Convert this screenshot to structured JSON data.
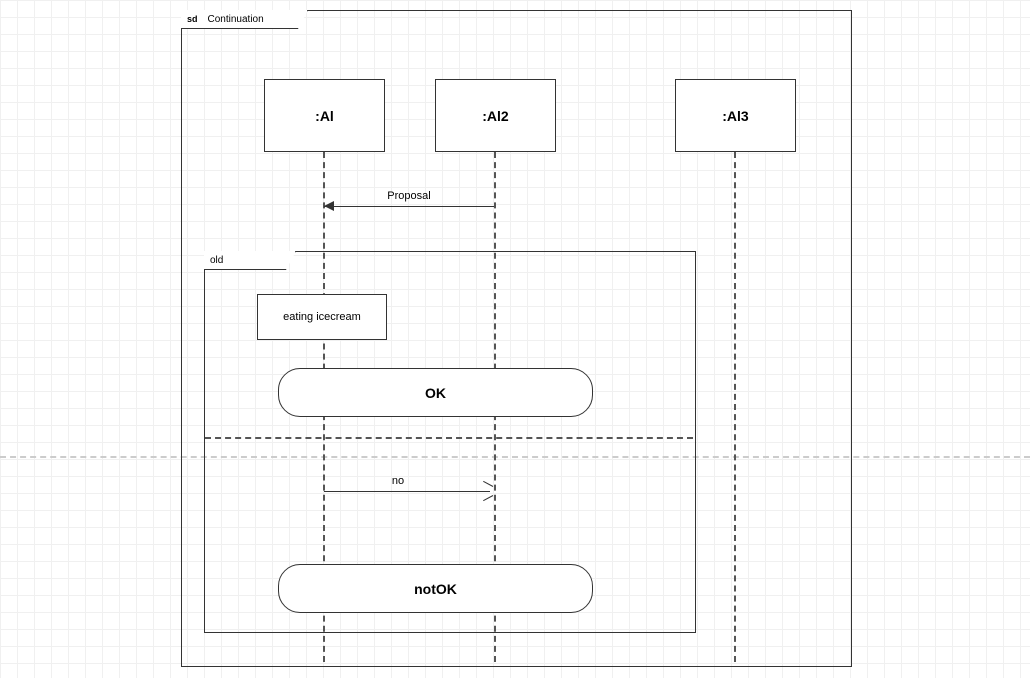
{
  "frame": {
    "sd": "sd",
    "title": "Continuation"
  },
  "lifelines": {
    "al": ":Al",
    "al2": ":Al2",
    "al3": ":Al3"
  },
  "messages": {
    "proposal": "Proposal",
    "no": "no"
  },
  "fragment": {
    "label": "old"
  },
  "states": {
    "eating": "eating icecream"
  },
  "continuations": {
    "ok": "OK",
    "notok": "notOK"
  }
}
